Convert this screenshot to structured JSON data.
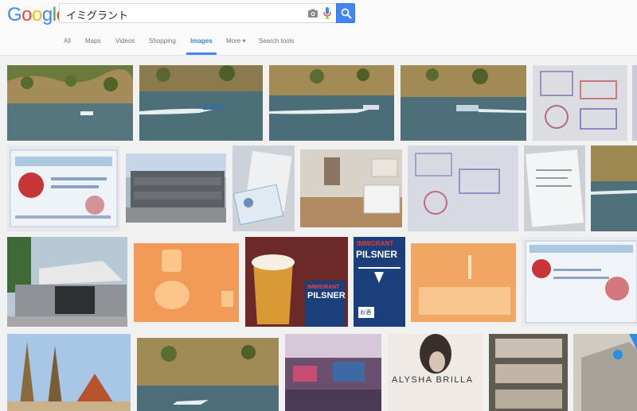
{
  "logo": {
    "letters": [
      "G",
      "o",
      "o",
      "g",
      "l",
      "e"
    ],
    "colors": [
      "#4285f4",
      "#ea4335",
      "#fbbc05",
      "#4285f4",
      "#34a853",
      "#ea4335"
    ]
  },
  "search": {
    "query": "イミグラント"
  },
  "tabs": [
    {
      "label": "All",
      "active": false
    },
    {
      "label": "Maps",
      "active": false
    },
    {
      "label": "Videos",
      "active": false
    },
    {
      "label": "Shopping",
      "active": false
    },
    {
      "label": "Images",
      "active": true
    },
    {
      "label": "More ▾",
      "active": false
    },
    {
      "label": "Search tools",
      "active": false
    }
  ],
  "results": {
    "texts": {
      "beer_label_top": "IMMIGRANT",
      "beer_label_main": "PILSNER",
      "beer_label_jp": "お酒",
      "glass_label_top": "IMMIGRANT",
      "glass_label_main": "PILSNER",
      "album_text": "ALYSHA BRILLA"
    }
  },
  "colors": {
    "accent": "#4285f4",
    "tab_text": "#777777",
    "background": "#f1f1f1"
  }
}
